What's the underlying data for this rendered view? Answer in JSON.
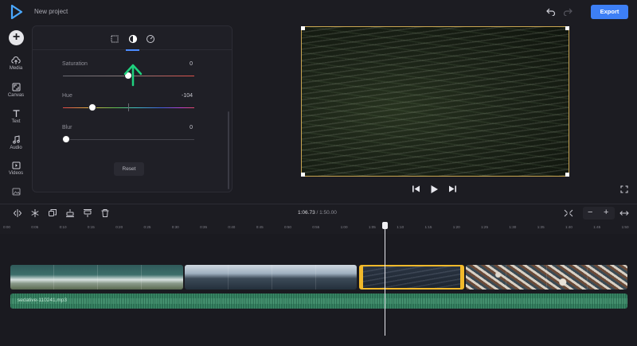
{
  "app": {
    "project_title": "New project"
  },
  "rail": {
    "items": [
      {
        "label": "Media",
        "icon": "cloud-upload-icon"
      },
      {
        "label": "Canvas",
        "icon": "canvas-resize-icon"
      },
      {
        "label": "Text",
        "icon": "text-icon"
      },
      {
        "label": "Audio",
        "icon": "music-note-icon"
      },
      {
        "label": "Videos",
        "icon": "video-icon"
      },
      {
        "label": "",
        "icon": "image-icon"
      }
    ]
  },
  "panel": {
    "tabs": [
      "crop-icon",
      "adjust-icon",
      "speed-icon"
    ],
    "active_tab": 1,
    "sliders": [
      {
        "label": "Saturation",
        "value": "0",
        "fraction": 0.5
      },
      {
        "label": "Hue",
        "value": "-104",
        "fraction": 0.23
      },
      {
        "label": "Blur",
        "value": "0",
        "fraction": 0.0
      }
    ],
    "reset_label": "Reset"
  },
  "header": {
    "export_label": "Export"
  },
  "timeline": {
    "current_time": "1:06.73",
    "separator": "/",
    "total_time": "1:50.00",
    "ruler_ticks": [
      "0:00",
      "0:05",
      "0:10",
      "0:15",
      "0:20",
      "0:25",
      "0:30",
      "0:35",
      "0:40",
      "0:45",
      "0:50",
      "0:55",
      "1:00",
      "1:05",
      "1:10",
      "1:15",
      "1:20",
      "1:25",
      "1:30",
      "1:35",
      "1:40",
      "1:45",
      "1:50"
    ],
    "audio_track_label": "sedative-110241.mp3",
    "zoom_minus": "−",
    "zoom_plus": "+"
  },
  "colors": {
    "accent": "#3d7ff5",
    "selected_clip_border": "#f1b92b",
    "audio_track": "#2b6f53"
  }
}
